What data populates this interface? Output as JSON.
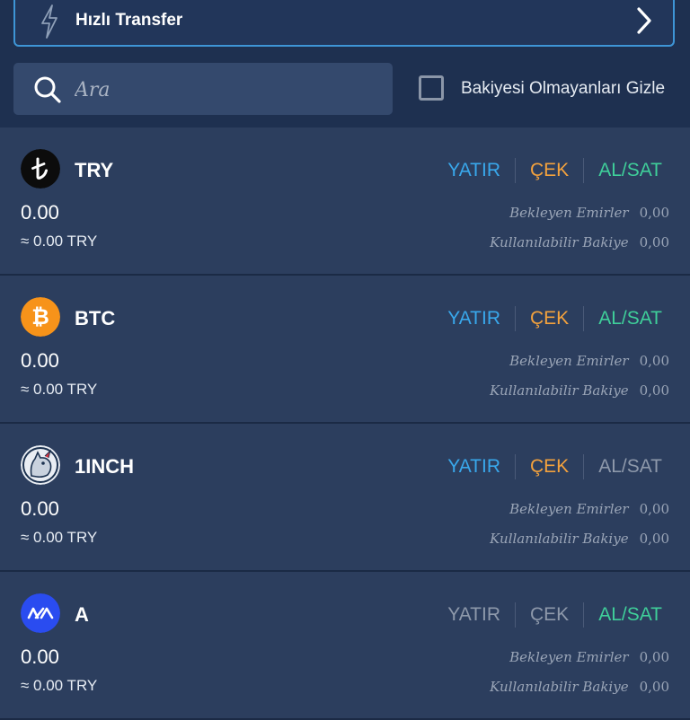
{
  "quick_transfer": {
    "label": "Hızlı Transfer"
  },
  "search": {
    "placeholder": "Ara"
  },
  "hide_zero": {
    "label": "Bakiyesi Olmayanları Gizle"
  },
  "labels": {
    "deposit": "YATIR",
    "withdraw": "ÇEK",
    "trade": "AL/SAT",
    "pending": "Bekleyen Emirler",
    "available": "Kullanılabilir Bakiye"
  },
  "colors": {
    "background": "#203250",
    "card": "#2c3e5e",
    "deposit": "#39a8ec",
    "withdraw": "#f4a23d",
    "trade": "#3fcf9a",
    "disabled": "#8e99ab"
  },
  "assets": [
    {
      "symbol": "TRY",
      "icon": "turkish-lira-icon",
      "balance": "0.00",
      "approx": "≈ 0.00 TRY",
      "pending": "0,00",
      "available": "0,00",
      "deposit_enabled": true,
      "withdraw_enabled": true,
      "trade_enabled": true
    },
    {
      "symbol": "BTC",
      "icon": "bitcoin-icon",
      "balance": "0.00",
      "approx": "≈ 0.00 TRY",
      "pending": "0,00",
      "available": "0,00",
      "deposit_enabled": true,
      "withdraw_enabled": true,
      "trade_enabled": true
    },
    {
      "symbol": "1INCH",
      "icon": "1inch-unicorn-icon",
      "balance": "0.00",
      "approx": "≈ 0.00 TRY",
      "pending": "0,00",
      "available": "0,00",
      "deposit_enabled": true,
      "withdraw_enabled": true,
      "trade_enabled": false
    },
    {
      "symbol": "A",
      "icon": "vaulta-icon",
      "balance": "0.00",
      "approx": "≈ 0.00 TRY",
      "pending": "0,00",
      "available": "0,00",
      "deposit_enabled": false,
      "withdraw_enabled": false,
      "trade_enabled": true
    }
  ]
}
